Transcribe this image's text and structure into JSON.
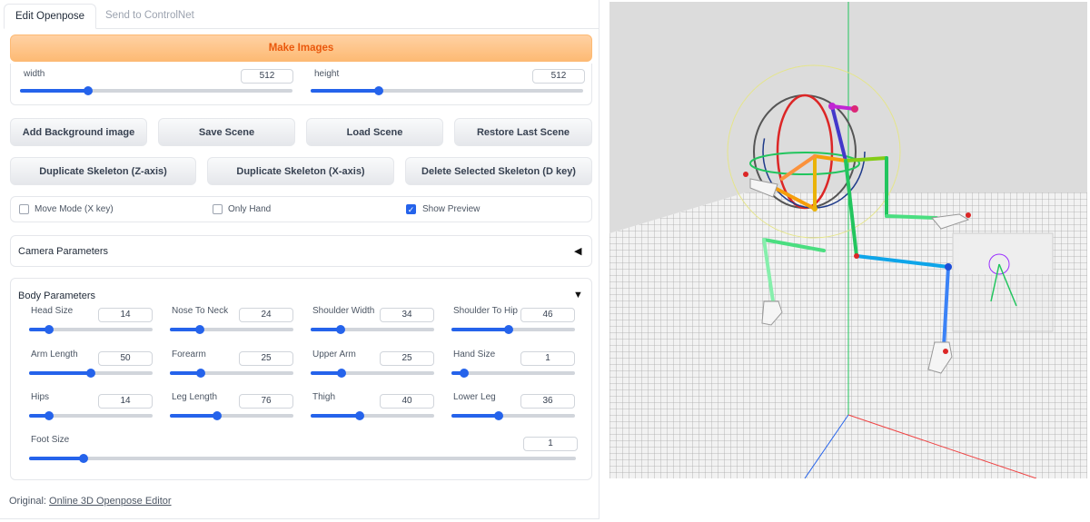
{
  "tabs": [
    {
      "label": "Edit Openpose",
      "active": true
    },
    {
      "label": "Send to ControlNet",
      "active": false
    }
  ],
  "make_images_label": "Make Images",
  "dims": {
    "width": {
      "label": "width",
      "value": "512",
      "fraction": 0.25
    },
    "height": {
      "label": "height",
      "value": "512",
      "fraction": 0.25
    }
  },
  "buttons_row1": [
    "Add Background image",
    "Save Scene",
    "Load Scene",
    "Restore Last Scene"
  ],
  "buttons_row2": [
    "Duplicate Skeleton (Z-axis)",
    "Duplicate Skeleton (X-axis)",
    "Delete Selected Skeleton (D key)"
  ],
  "checks": [
    {
      "label": "Move Mode (X key)",
      "checked": false
    },
    {
      "label": "Only Hand",
      "checked": false
    },
    {
      "label": "Show Preview",
      "checked": true
    }
  ],
  "camera_title": "Camera Parameters",
  "body_title": "Body Parameters",
  "params": [
    {
      "label": "Head Size",
      "value": "14",
      "fraction": 0.16
    },
    {
      "label": "Nose To Neck",
      "value": "24",
      "fraction": 0.24
    },
    {
      "label": "Shoulder Width",
      "value": "34",
      "fraction": 0.24
    },
    {
      "label": "Shoulder To Hip",
      "value": "46",
      "fraction": 0.46
    },
    {
      "label": "Arm Length",
      "value": "50",
      "fraction": 0.5
    },
    {
      "label": "Forearm",
      "value": "25",
      "fraction": 0.25
    },
    {
      "label": "Upper Arm",
      "value": "25",
      "fraction": 0.25
    },
    {
      "label": "Hand Size",
      "value": "1",
      "fraction": 0.1
    },
    {
      "label": "Hips",
      "value": "14",
      "fraction": 0.16
    },
    {
      "label": "Leg Length",
      "value": "76",
      "fraction": 0.38
    },
    {
      "label": "Thigh",
      "value": "40",
      "fraction": 0.4
    },
    {
      "label": "Lower Leg",
      "value": "36",
      "fraction": 0.38
    },
    {
      "label": "Foot Size",
      "value": "1",
      "fraction": 0.1
    }
  ],
  "footer": {
    "prefix": "Original: ",
    "link": "Online 3D Openpose Editor"
  },
  "colors": {
    "accent": "#2563eb",
    "make_images_text": "#ea580c",
    "make_images_bg": "#fdba74",
    "viewport_bg": "#dcdcdc"
  }
}
